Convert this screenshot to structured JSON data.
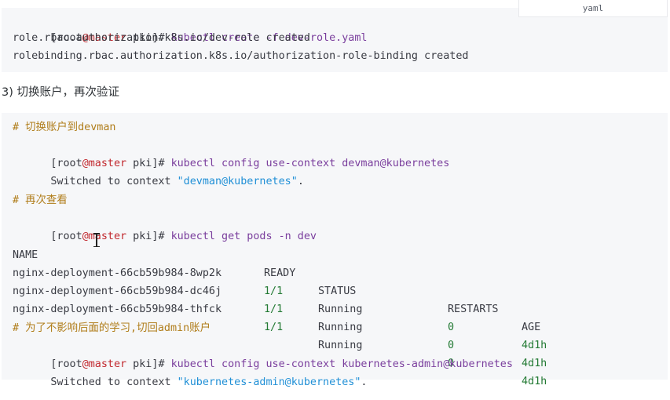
{
  "block1": {
    "lang": "yaml",
    "lines": [
      {
        "prompt_open": "[root",
        "at_host": "@master",
        "prompt_rest": " pki]",
        "hash": "# ",
        "command": "kubectl create -f dev-role.yaml"
      },
      {
        "text": "role.rbac.authorization.k8s.io/dev-role created"
      },
      {
        "text": "rolebinding.rbac.authorization.k8s.io/authorization-role-binding created"
      }
    ]
  },
  "step_heading": "3) 切换账户，再次验证",
  "block2": {
    "comment1": "# 切换账户到devman",
    "cmd1": {
      "prompt_open": "[root",
      "at_host": "@master",
      "prompt_rest": " pki]",
      "hash": "# ",
      "command": "kubectl config use-context devman@kubernetes"
    },
    "switch1": {
      "prefix": "Switched to context ",
      "context": "\"devman@kubernetes\"",
      "suffix": "."
    },
    "comment2": "# 再次查看",
    "cmd2": {
      "prompt_open": "[root",
      "at_host": "@master",
      "prompt_rest": " pki]",
      "hash": "# ",
      "command": "kubectl get pods -n dev"
    },
    "table": {
      "headers": [
        "NAME",
        "READY",
        "STATUS",
        "RESTARTS",
        "AGE"
      ],
      "rows": [
        [
          "nginx-deployment-66cb59b984-8wp2k",
          "1/1",
          "Running",
          "0",
          "4d1h"
        ],
        [
          "nginx-deployment-66cb59b984-dc46j",
          "1/1",
          "Running",
          "0",
          "4d1h"
        ],
        [
          "nginx-deployment-66cb59b984-thfck",
          "1/1",
          "Running",
          "0",
          "4d1h"
        ]
      ]
    },
    "comment3": "# 为了不影响后面的学习,切回admin账户",
    "cmd3": {
      "prompt_open": "[root",
      "at_host": "@master",
      "prompt_rest": " pki]",
      "hash": "# ",
      "command": "kubectl config use-context kubernetes-admin@kubernetes"
    },
    "switch2": {
      "prefix": "Switched to context ",
      "context": "\"kubernetes-admin@kubernetes\"",
      "suffix": "."
    }
  },
  "icons": {
    "cursor": "text-cursor-icon"
  },
  "colors": {
    "code_bg": "#f6f7f9",
    "comment": "#b07d1a",
    "host": "#c1272d",
    "command": "#7a3e9d",
    "string": "#1f8fd6",
    "number": "#237a34"
  }
}
